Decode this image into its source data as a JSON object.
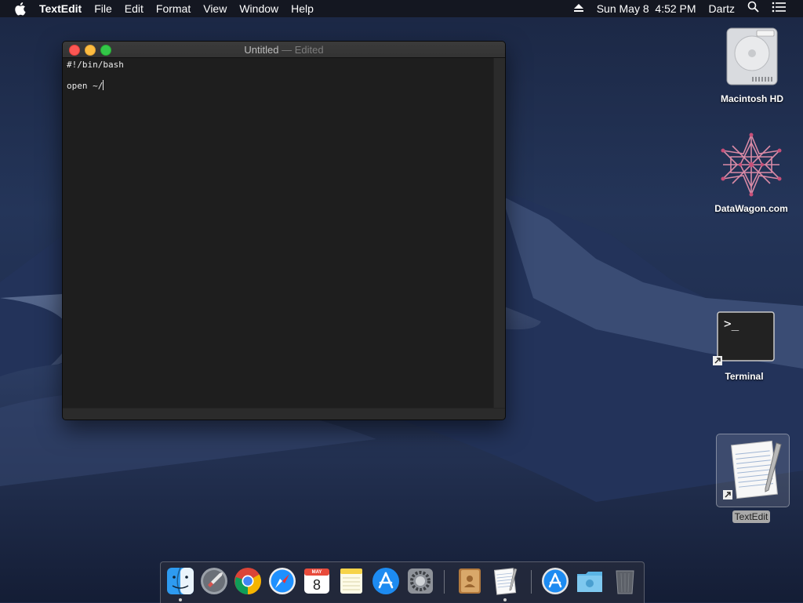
{
  "menubar": {
    "app_name": "TextEdit",
    "items": [
      "File",
      "Edit",
      "Format",
      "View",
      "Window",
      "Help"
    ],
    "clock": "Sun May 8  4:52 PM",
    "user": "Dartz"
  },
  "window": {
    "title": "Untitled",
    "title_separator": " — ",
    "title_status": "Edited",
    "lines": [
      "#!/bin/bash",
      "",
      "open ~/"
    ]
  },
  "desktop": {
    "icons": [
      {
        "label": "Macintosh HD",
        "icon": "hard-drive-icon"
      },
      {
        "label": "DataWagon.com",
        "icon": "star-network-icon"
      },
      {
        "label": "Terminal",
        "icon": "terminal-icon"
      },
      {
        "label": "TextEdit",
        "icon": "textedit-icon"
      }
    ]
  },
  "dock": {
    "calendar_month": "MAY",
    "calendar_day": "8",
    "items": [
      "finder-icon",
      "launchpad-icon",
      "chrome-icon",
      "safari-icon",
      "calendar-icon",
      "notes-icon",
      "app-store-icon",
      "system-preferences-icon",
      "contacts-icon",
      "textedit-icon",
      "app-store-download-icon",
      "downloads-folder-icon",
      "trash-icon"
    ]
  },
  "colors": {
    "close": "#fc5753",
    "minimize": "#fdbc40",
    "maximize": "#33c748",
    "menubar": "#14161e",
    "editor_bg": "#1e1e1e"
  }
}
